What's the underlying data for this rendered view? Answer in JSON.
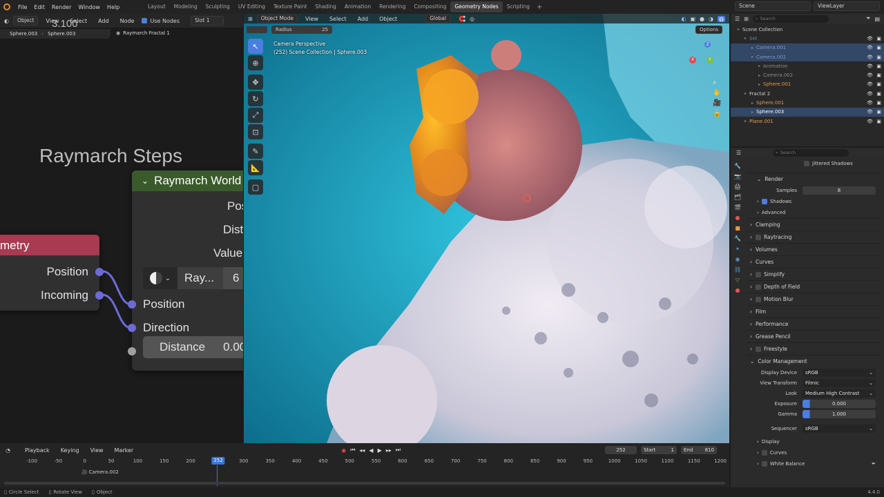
{
  "menu": {
    "items": [
      "File",
      "Edit",
      "Render",
      "Window",
      "Help"
    ]
  },
  "workspaces": {
    "tabs": [
      "Layout",
      "Modeling",
      "Sculpting",
      "UV Editing",
      "Texture Paint",
      "Shading",
      "Animation",
      "Rendering",
      "Compositing",
      "Geometry Nodes",
      "Scripting"
    ],
    "active": "Geometry Nodes"
  },
  "header_right": {
    "scene": "Scene",
    "view_layer": "ViewLayer"
  },
  "node_editor": {
    "header": {
      "type": "Object",
      "menus": [
        "View",
        "Select",
        "Add",
        "Node"
      ],
      "use_nodes": "Use Nodes",
      "slot": "Slot 1"
    },
    "breadcrumbs": [
      "Sphere.003",
      "Sphere.003",
      "Raymarch Fractal 1"
    ],
    "top_value": "3.100",
    "frame_label": "Raymarch Steps",
    "node_world": {
      "title": "Raymarch World",
      "outputs": [
        "Pos",
        "Dist",
        "Value"
      ],
      "group_name": "Ray...",
      "group_users": "6",
      "inputs": [
        "Position",
        "Direction"
      ],
      "distance_label": "Distance",
      "distance_value": "0.00"
    },
    "node_geometry": {
      "title": "metry",
      "outputs": [
        "Position",
        "Incoming"
      ]
    },
    "colors": {
      "geometry_header": "#a83a52",
      "world_header": "#3a5a2c",
      "socket_vector": "#6d6ad8"
    }
  },
  "viewport": {
    "header": {
      "mode": "Object Mode",
      "menus": [
        "View",
        "Select",
        "Add",
        "Object"
      ],
      "orientation": "Global"
    },
    "tool_settings": {
      "radius_label": "Radius",
      "radius_value": "25",
      "options": "Options"
    },
    "info_line1": "Camera Perspective",
    "info_line2": "(252) Scene Collection | Sphere.003",
    "gizmo": {
      "x": "X",
      "y": "Y",
      "z": "Z"
    }
  },
  "outliner": {
    "search_placeholder": "Search",
    "rows": [
      {
        "label": "Scene Collection",
        "indent": 0,
        "color": "#d0d0d0",
        "selected": false
      },
      {
        "label": "Set",
        "indent": 1,
        "color": "#5f7fb0",
        "selected": false
      },
      {
        "label": "Camera.001",
        "indent": 2,
        "color": "#7f9ac4",
        "selected": true
      },
      {
        "label": "Camera.002",
        "indent": 2,
        "color": "#7f9ac4",
        "selected": true
      },
      {
        "label": "Animation",
        "indent": 3,
        "color": "#8a8a8a",
        "selected": false
      },
      {
        "label": "Camera.002",
        "indent": 3,
        "color": "#8a8a8a",
        "selected": false
      },
      {
        "label": "Sphere.001",
        "indent": 3,
        "color": "#e39a4c",
        "selected": false
      },
      {
        "label": "Fractal 2",
        "indent": 1,
        "color": "#d0d0d0",
        "selected": false
      },
      {
        "label": "Sphere.001",
        "indent": 2,
        "color": "#e39a4c",
        "selected": false
      },
      {
        "label": "Sphere.003",
        "indent": 2,
        "color": "#ffffff",
        "selected": true
      },
      {
        "label": "Plane.001",
        "indent": 1,
        "color": "#e39a4c",
        "selected": false
      }
    ]
  },
  "properties": {
    "search_placeholder": "Search",
    "jittered_shadows": "Jittered Shadows",
    "render_label": "Render",
    "samples_label": "Samples",
    "samples_value": "8",
    "shadows": "Shadows",
    "advanced": "Advanced",
    "sections": [
      "Clamping",
      "Raytracing",
      "Volumes",
      "Curves",
      "Simplify",
      "Depth of Field",
      "Motion Blur",
      "Film",
      "Performance",
      "Grease Pencil",
      "Freestyle"
    ],
    "color_management": {
      "title": "Color Management",
      "display_device_label": "Display Device",
      "display_device": "sRGB",
      "view_transform_label": "View Transform",
      "view_transform": "Filmic",
      "look_label": "Look",
      "look": "Medium High Contrast",
      "exposure_label": "Exposure",
      "exposure": "0.000",
      "gamma_label": "Gamma",
      "gamma": "1.000",
      "sequencer_label": "Sequencer",
      "sequencer": "sRGB",
      "display": "Display",
      "curves": "Curves",
      "white_balance": "White Balance"
    }
  },
  "timeline": {
    "menus": [
      "Playback",
      "Keying",
      "View",
      "Marker"
    ],
    "current_frame": "252",
    "start_label": "Start",
    "start": "1",
    "end_label": "End",
    "end": "810",
    "ticks": [
      "-100",
      "-50",
      "0",
      "50",
      "100",
      "150",
      "200",
      "250",
      "300",
      "350",
      "400",
      "450",
      "500",
      "550",
      "600",
      "650",
      "700",
      "750",
      "800",
      "850",
      "900",
      "950",
      "1000",
      "1050",
      "1100",
      "1150",
      "1200"
    ],
    "marker": "Camera.002",
    "accent": "#3a77d6"
  },
  "statusbar": {
    "items": [
      "Circle Select",
      "Rotate View",
      "Object"
    ],
    "version": "4.4.0"
  }
}
